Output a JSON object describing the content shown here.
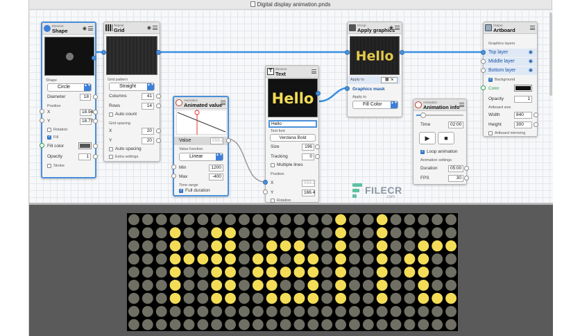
{
  "window": {
    "title": "Digital display animation.pnds"
  },
  "shape_node": {
    "category": "Element",
    "name": "Shape",
    "shape_label": "Shape",
    "shape_value": "Circle",
    "diameter_label": "Diameter",
    "diameter": "18",
    "position_label": "Position",
    "x_label": "X",
    "x": "18.94",
    "y_label": "Y",
    "y": "18.77",
    "rotation_label": "Rotation",
    "fill_label": "Fill",
    "fill_color_label": "Fill color",
    "opacity_label": "Opacity",
    "opacity": "1",
    "stroke_label": "Stroke"
  },
  "grid_node": {
    "category": "Repeat",
    "name": "Grid",
    "pattern_label": "Grid pattern",
    "pattern": "Straight",
    "columns_label": "Columns",
    "columns": "41",
    "rows_label": "Rows",
    "rows": "14",
    "autocount_label": "Auto count",
    "spacing_label": "Grid spacing",
    "x_label": "X",
    "x": "20",
    "y_label": "Y",
    "y": "20",
    "autospacing_label": "Auto spacing",
    "extra_label": "Extra settings"
  },
  "anim_value_node": {
    "category": "Animation",
    "name": "Animated value",
    "value_label": "Value",
    "value": "559.2",
    "function_label": "Value function",
    "function": "Linear",
    "min_label": "Min",
    "min": "1200",
    "max_label": "Max",
    "max": "-400",
    "time_label": "Time range",
    "full_duration_label": "Full duration"
  },
  "text_node": {
    "category": "Element",
    "name": "Text",
    "preview_text": "Hello",
    "text_value": "Hello",
    "font_label": "Text font",
    "font": "Verdana Bold",
    "size_label": "Size",
    "size": "196",
    "tracking_label": "Tracking",
    "tracking": "0",
    "multiline_label": "Multiple lines",
    "position_label": "Position",
    "x_label": "X",
    "x": "559.2",
    "y_label": "Y",
    "y": "166.4",
    "rotation_label": "Rotation"
  },
  "group_node": {
    "category": "Group",
    "name": "Apply graphics",
    "preview_text": "Hello",
    "apply_to_label": "Apply to",
    "mask_label": "Graphics mask",
    "apply_to2_label": "Apply to",
    "apply_to2": "Fill Color"
  },
  "anim_info_node": {
    "category": "Animation",
    "name": "Animation info",
    "time_label": "Time",
    "time": "02:00",
    "play_icon": "play-icon",
    "stop_icon": "stop-icon",
    "loop_label": "Loop animation",
    "settings_label": "Animation settings",
    "duration_label": "Duration",
    "duration": "05:00",
    "fps_label": "FPS",
    "fps": "30"
  },
  "artboard_node": {
    "category": "Output",
    "name": "Artboard",
    "layers_label": "Graphics layers",
    "layers": [
      "Top layer",
      "Middle layer",
      "Bottom layer"
    ],
    "background_label": "Background",
    "color_label": "Color",
    "opacity_label": "Opacity",
    "opacity": "1",
    "size_label": "Artboard size",
    "width_label": "Width",
    "width": "840",
    "height_label": "Height",
    "height": "300",
    "mirroring_label": "Artboard mirroring"
  },
  "display": {
    "text": "Hello",
    "lit_color": "#f3dc57",
    "off_color": "#6f6f64",
    "columns": 24,
    "rows": 9
  },
  "watermark": {
    "brand": "FILECR",
    "domain": ".com"
  },
  "colors": {
    "accent": "#4a90d9",
    "wire": "#3b8fe0",
    "selection": "#4a90d9"
  }
}
